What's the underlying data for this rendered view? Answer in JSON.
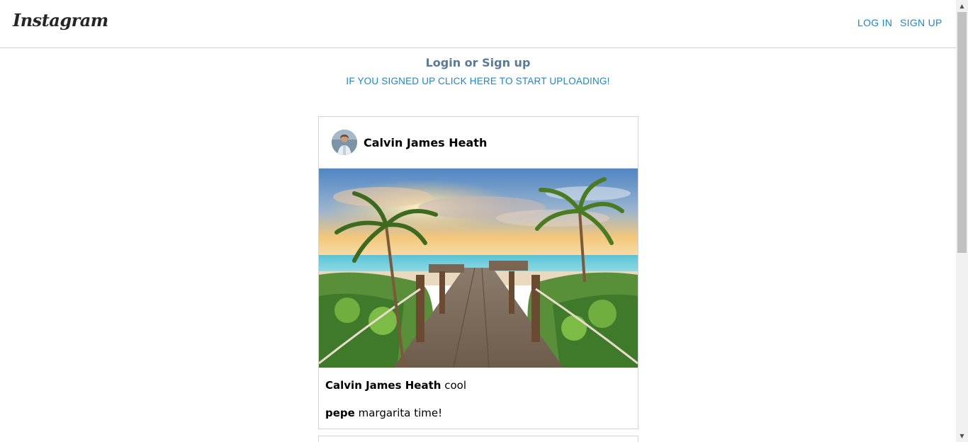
{
  "header": {
    "logo": "Instagram",
    "login_label": "LOG IN",
    "signup_label": "SIGN UP"
  },
  "intro": {
    "title": "Login or Sign up",
    "upload_link": "IF YOU SIGNED UP CLICK HERE TO START UPLOADING!"
  },
  "posts": [
    {
      "username": "Calvin James Heath",
      "image_alt": "beach boardwalk with palm trees at sunset",
      "comments": [
        {
          "user": "Calvin James Heath",
          "text": "cool"
        },
        {
          "user": "pepe",
          "text": "margarita time!"
        }
      ]
    }
  ],
  "colors": {
    "link": "#1b87d1",
    "intro_title": "#5a7a95",
    "border": "#d4d4d4"
  }
}
